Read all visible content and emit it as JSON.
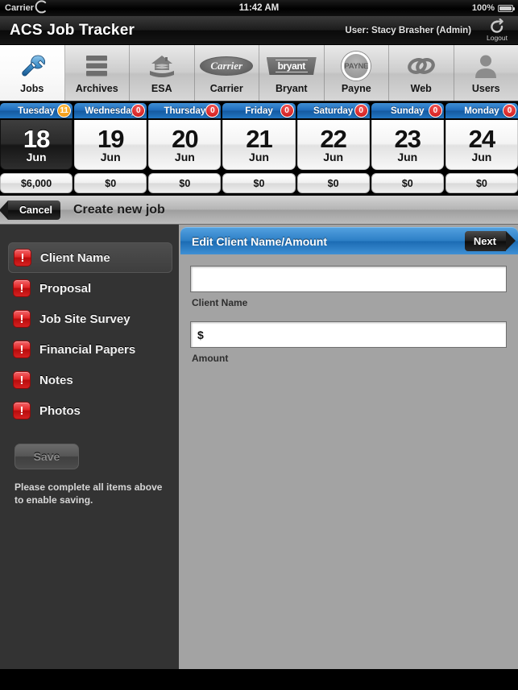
{
  "status_bar": {
    "carrier": "Carrier",
    "wifi_icon": "wifi-icon",
    "time": "11:42 AM",
    "battery_percent": "100%",
    "battery_icon": "battery-full-icon"
  },
  "title_bar": {
    "app_title": "ACS Job Tracker",
    "user": "User: Stacy Brasher (Admin)",
    "logout_label": "Logout",
    "logout_icon": "logout-icon"
  },
  "tabs": [
    {
      "label": "Jobs",
      "icon": "wrench-icon",
      "selected": true
    },
    {
      "label": "Archives",
      "icon": "archives-icon",
      "selected": false
    },
    {
      "label": "ESA",
      "icon": "house-icon",
      "selected": false
    },
    {
      "label": "Carrier",
      "icon": "carrier-logo-icon",
      "logo_text": "Carrier",
      "selected": false
    },
    {
      "label": "Bryant",
      "icon": "bryant-logo-icon",
      "logo_text": "bryant",
      "selected": false
    },
    {
      "label": "Payne",
      "icon": "payne-logo-icon",
      "logo_text": "PAYNE",
      "selected": false
    },
    {
      "label": "Web",
      "icon": "web-links-icon",
      "selected": false
    },
    {
      "label": "Users",
      "icon": "user-icon",
      "selected": false
    }
  ],
  "date_strip": {
    "days": [
      {
        "name": "Tuesday",
        "count": "11",
        "badge_color": "orange",
        "day": "18",
        "month": "Jun",
        "amount": "$6,000",
        "today": true
      },
      {
        "name": "Wednesday",
        "count": "0",
        "badge_color": "red",
        "day": "19",
        "month": "Jun",
        "amount": "$0",
        "today": false
      },
      {
        "name": "Thursday",
        "count": "0",
        "badge_color": "red",
        "day": "20",
        "month": "Jun",
        "amount": "$0",
        "today": false
      },
      {
        "name": "Friday",
        "count": "0",
        "badge_color": "red",
        "day": "21",
        "month": "Jun",
        "amount": "$0",
        "today": false
      },
      {
        "name": "Saturday",
        "count": "0",
        "badge_color": "red",
        "day": "22",
        "month": "Jun",
        "amount": "$0",
        "today": false
      },
      {
        "name": "Sunday",
        "count": "0",
        "badge_color": "red",
        "day": "23",
        "month": "Jun",
        "amount": "$0",
        "today": false
      },
      {
        "name": "Monday",
        "count": "0",
        "badge_color": "red",
        "day": "24",
        "month": "Jun",
        "amount": "$0",
        "today": false
      }
    ]
  },
  "sub_toolbar": {
    "cancel_label": "Cancel",
    "title": "Create new job"
  },
  "sidebar": {
    "items": [
      {
        "label": "Client Name",
        "icon": "alert-exclamation-icon",
        "mark": "!",
        "active": true
      },
      {
        "label": "Proposal",
        "icon": "alert-exclamation-icon",
        "mark": "!",
        "active": false
      },
      {
        "label": "Job Site Survey",
        "icon": "alert-exclamation-icon",
        "mark": "!",
        "active": false
      },
      {
        "label": "Financial Papers",
        "icon": "alert-exclamation-icon",
        "mark": "!",
        "active": false
      },
      {
        "label": "Notes",
        "icon": "alert-exclamation-icon",
        "mark": "!",
        "active": false
      },
      {
        "label": "Photos",
        "icon": "alert-exclamation-icon",
        "mark": "!",
        "active": false
      }
    ],
    "save_label": "Save",
    "save_enabled": false,
    "hint": "Please complete all items above to enable saving."
  },
  "panel": {
    "title": "Edit Client Name/Amount",
    "next_label": "Next",
    "fields": [
      {
        "value": "",
        "placeholder": "",
        "label": "Client Name"
      },
      {
        "value": "$",
        "placeholder": "",
        "label": "Amount"
      }
    ]
  },
  "colors": {
    "accent_blue": "#2d7fc6",
    "sidebar_bg": "#333333",
    "panel_bg": "#a3a3a3",
    "badge_red": "#cc1111",
    "badge_orange": "#ef8f06",
    "alert_red": "#e02626"
  }
}
